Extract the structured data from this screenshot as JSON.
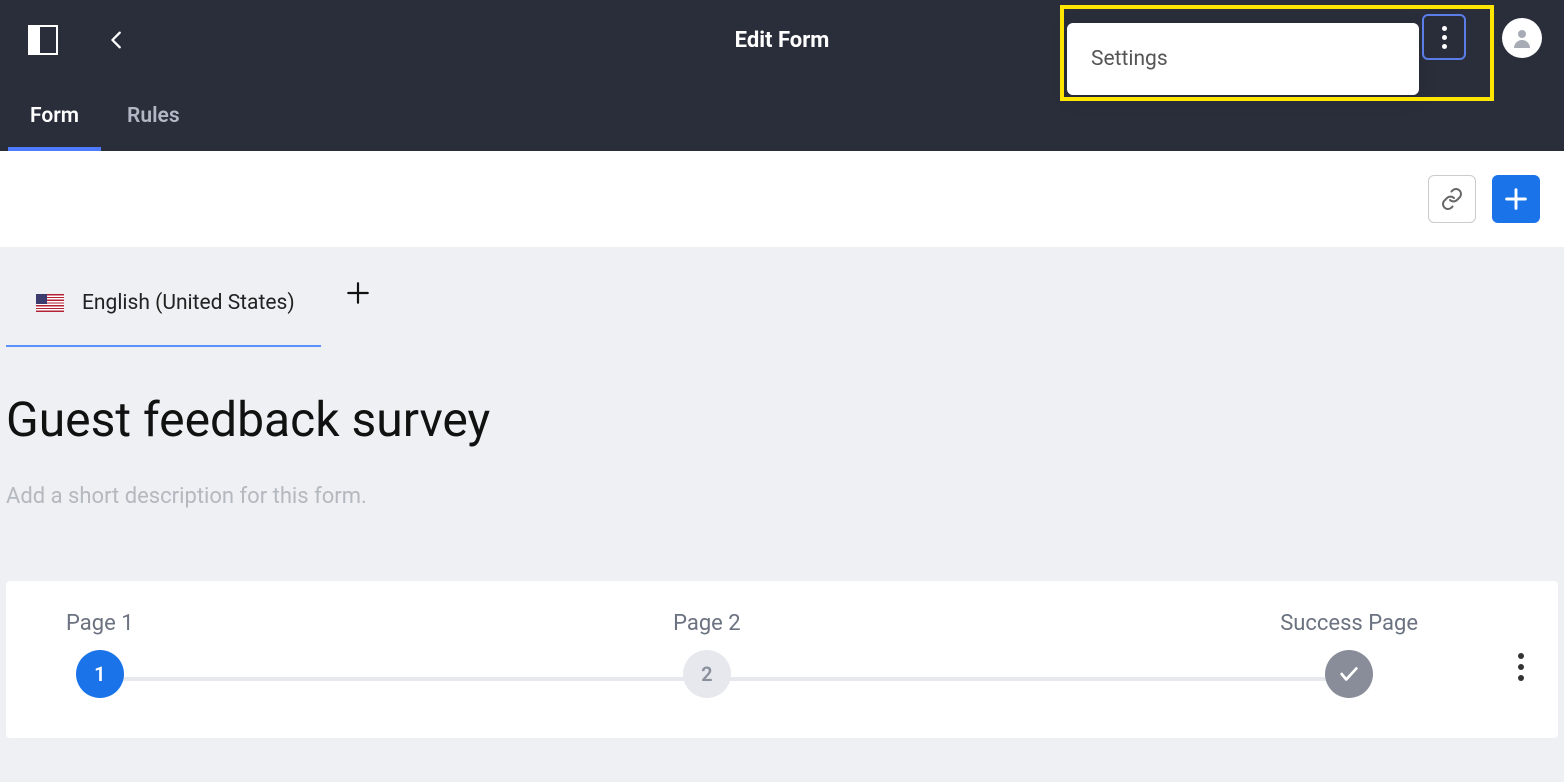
{
  "header": {
    "title": "Edit Form",
    "menu_item": "Settings"
  },
  "tabs": {
    "form": "Form",
    "rules": "Rules"
  },
  "language": {
    "label": "English (United States)"
  },
  "form": {
    "title": "Guest feedback survey",
    "description_placeholder": "Add a short description for this form."
  },
  "stepper": {
    "page1_label": "Page 1",
    "page1_num": "1",
    "page2_label": "Page 2",
    "page2_num": "2",
    "success_label": "Success Page"
  }
}
